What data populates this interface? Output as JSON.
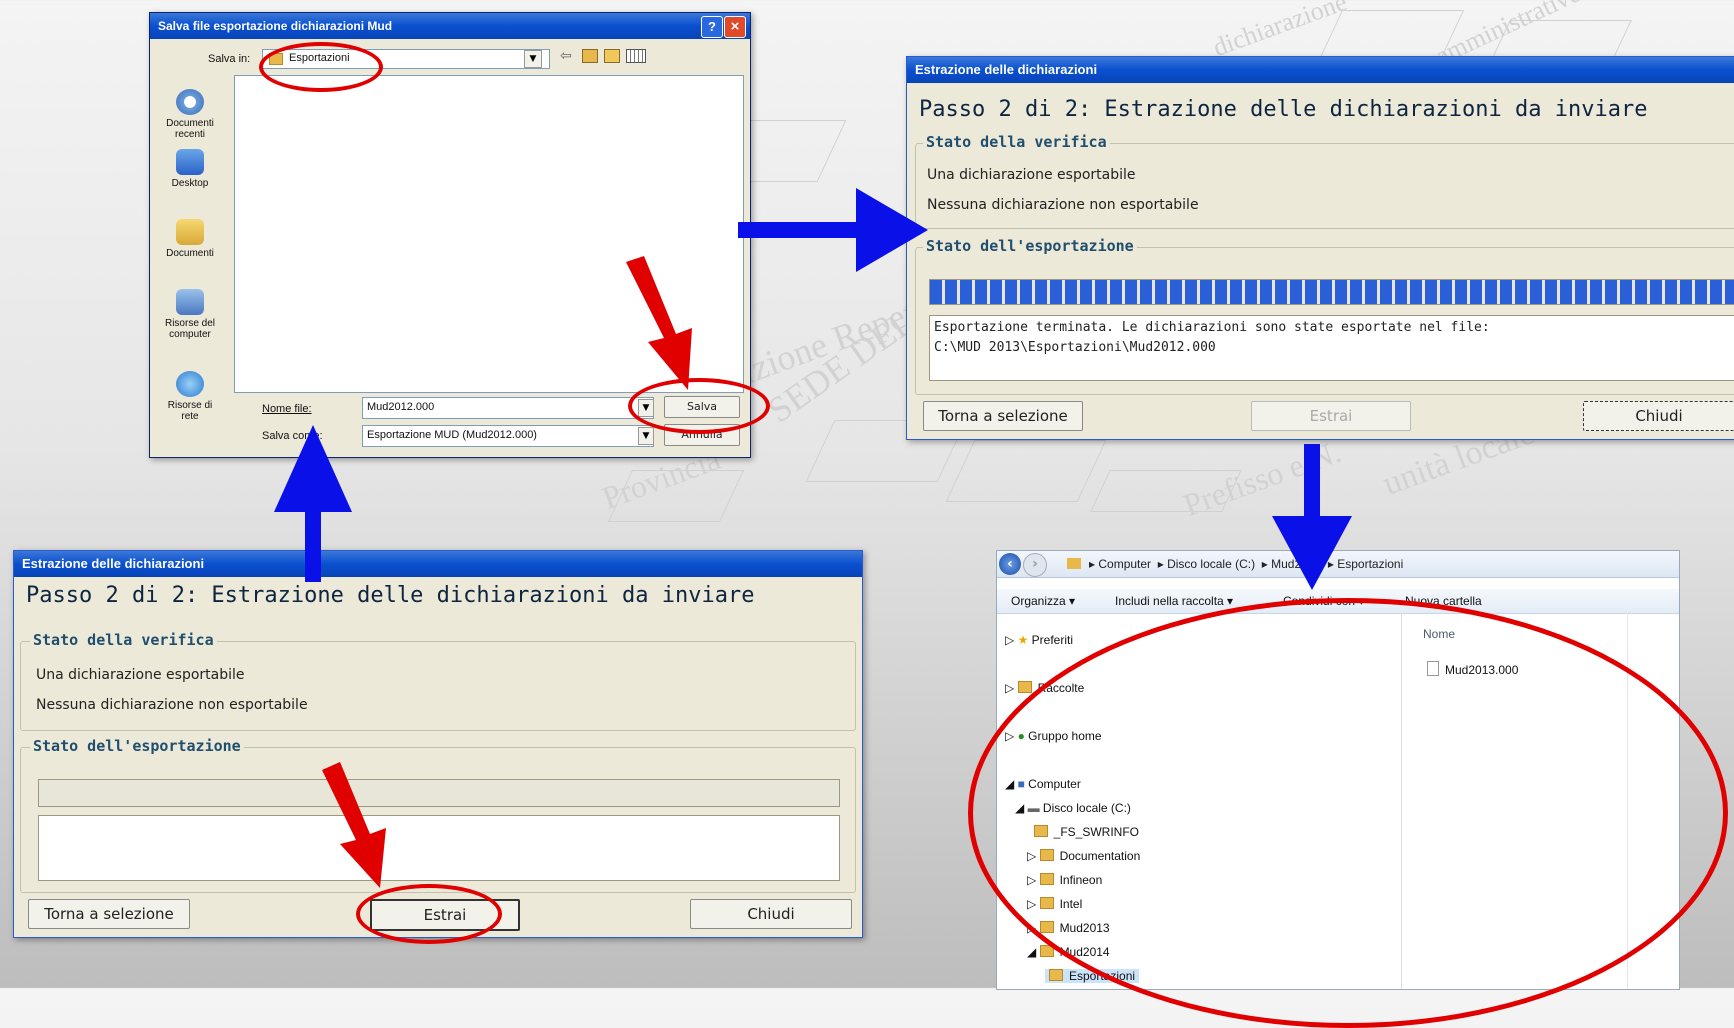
{
  "save_dialog": {
    "title": "Salva file esportazione dichiarazioni Mud",
    "save_in_label": "Salva in:",
    "save_in_value": "Esportazioni",
    "places": [
      "Documenti recenti",
      "Desktop",
      "Documenti",
      "Risorse del computer",
      "Risorse di rete"
    ],
    "filename_label": "Nome file:",
    "filename_value": "Mud2012.000",
    "savetype_label": "Salva come:",
    "savetype_value": "Esportazione MUD (Mud2012.000)",
    "save_button": "Salva",
    "cancel_button": "Annulla",
    "help_glyph": "?",
    "close_glyph": "×"
  },
  "extract_dialog_before": {
    "title": "Estrazione delle dichiarazioni",
    "step_heading": "Passo 2 di 2: Estrazione delle dichiarazioni da inviare",
    "verify_group": "Stato della verifica",
    "line1": "Una dichiarazione esportabile",
    "line2": "Nessuna dichiarazione non esportabile",
    "export_group": "Stato dell'esportazione",
    "back_button": "Torna a selezione",
    "extract_button": "Estrai",
    "close_button": "Chiudi",
    "progress": 0
  },
  "extract_dialog_after": {
    "title": "Estrazione delle dichiarazioni",
    "step_heading": "Passo 2 di 2: Estrazione delle dichiarazioni da inviare",
    "verify_group": "Stato della verifica",
    "line1": "Una dichiarazione esportabile",
    "line2": "Nessuna dichiarazione non esportabile",
    "export_group": "Stato dell'esportazione",
    "result_line1": "Esportazione terminata. Le dichiarazioni sono state esportate nel file:",
    "result_line2": "C:\\MUD 2013\\Esportazioni\\Mud2012.000",
    "back_button": "Torna a selezione",
    "extract_button": "Estrai",
    "close_button": "Chiudi",
    "progress": 1.0
  },
  "explorer": {
    "breadcrumb": [
      "Computer",
      "Disco locale (C:)",
      "Mud2014",
      "Esportazioni"
    ],
    "toolbar": [
      "Organizza ▾",
      "Includi nella raccolta ▾",
      "Condividi con ▾",
      "Nuova cartella"
    ],
    "column_header": "Nome",
    "files": [
      "Mud2013.000"
    ],
    "nav": {
      "favorites": "Preferiti",
      "libraries": "Raccolte",
      "homegroup": "Gruppo home",
      "computer": "Computer",
      "drive": "Disco locale (C:)",
      "folders": [
        "_FS_SWRINFO",
        "Documentation",
        "Infineon",
        "Intel",
        "Mud2013",
        "Mud2014"
      ],
      "subfolder": "Esportazioni"
    }
  },
  "background_text": [
    "Numero Iscrizione Repertorio",
    "Provincia",
    "Prefisso e N.",
    "unità locale",
    "SEDE DELL'UNITA' LOCALE",
    "dichiarazione",
    "amministrative"
  ],
  "colors": {
    "arrow_blue": "#0a10e8",
    "highlight_red": "#e00000",
    "xp_title": "#0a50d0",
    "progress_blue": "#2a5fd8"
  }
}
